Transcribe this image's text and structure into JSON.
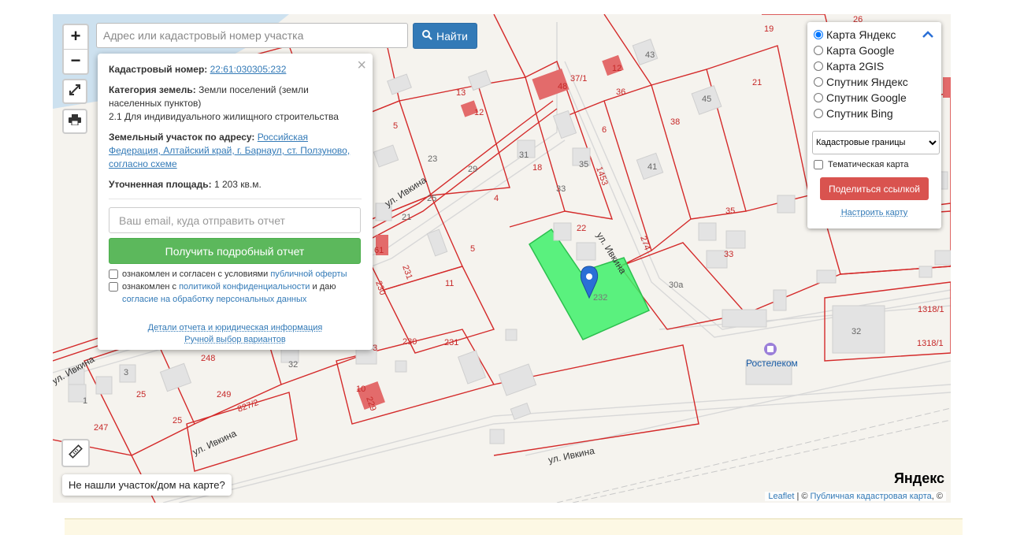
{
  "search": {
    "placeholder": "Адрес или кадастровый номер участка",
    "button_label": "Найти"
  },
  "zoom": {
    "in_label": "+",
    "out_label": "−"
  },
  "popup": {
    "close_label": "×",
    "cadastral_label": "Кадастровый номер:",
    "cadastral_value": "22:61:030305:232",
    "category_label": "Категория земель:",
    "category_value": "Земли поселений (земли населенных пунктов)",
    "use_value": "2.1 Для индивидуального жилищного строительства",
    "address_label": "Земельный участок по адресу:",
    "address_value": "Российская Федерация, Алтайский край, г. Барнаул, ст. Ползуново, согласно схеме",
    "area_label": "Уточненная площадь:",
    "area_value": "1 203 кв.м.",
    "email_placeholder": "Ваш email, куда отправить отчет",
    "report_button": "Получить подробный отчет",
    "consent1_prefix": "ознакомлен и согласен с условиями ",
    "consent1_link": "публичной оферты",
    "consent2_prefix": "ознакомлен с ",
    "consent2_link": "политикой конфиденциальности",
    "consent2_suffix": " и даю",
    "consent2_link2": "согласие на обработку персональных данных",
    "details_link": "Детали отчета и юридическая информация",
    "manual_link": "Ручной выбор вариантов"
  },
  "layers": {
    "options": [
      "Карта Яндекс",
      "Карта Google",
      "Карта 2GIS",
      "Спутник Яндекс",
      "Спутник Google",
      "Спутник Bing"
    ],
    "selected_index": 0,
    "overlay_select": "Кадастровые границы",
    "thematic_label": "Тематическая карта",
    "share_button": "Поделиться ссылкой",
    "configure_link": "Настроить карту"
  },
  "map": {
    "not_found": "Не нашли участок/дом на карте?",
    "attribution_leaflet": "Leaflet",
    "attribution_sep": " | © ",
    "attribution_pkk": "Публичная кадастровая карта",
    "attribution_tail": ", ©",
    "provider_logo": "Яндекс",
    "poi_label": "Ростелеком",
    "streets": [
      "ул. Ивкина",
      "ул. Ивкина",
      "ул. Ивкина",
      "ул. Ивкина",
      "ул. Ивкина"
    ],
    "parcel_labels": [
      "13",
      "12",
      "5",
      "23",
      "29",
      "31",
      "18",
      "4",
      "25",
      "21",
      "61",
      "5",
      "230",
      "231",
      "11",
      "230",
      "231",
      "3",
      "248",
      "32",
      "249",
      "25",
      "1",
      "247",
      "25",
      "827/2",
      "10",
      "229",
      "48",
      "37/1",
      "12",
      "36",
      "6",
      "35",
      "1453",
      "33",
      "22",
      "274",
      "232",
      "43",
      "45",
      "38",
      "41",
      "35",
      "33",
      "30а",
      "19",
      "26",
      "21",
      "32",
      "1318/1",
      "1318/1"
    ],
    "selected_parcel": "232",
    "colors": {
      "parcel_border": "#d42a2a",
      "selected_fill": "#3ef06a",
      "building": "#e2e2e2",
      "background": "#f5f3ee",
      "marker": "#2a6fd6"
    }
  }
}
